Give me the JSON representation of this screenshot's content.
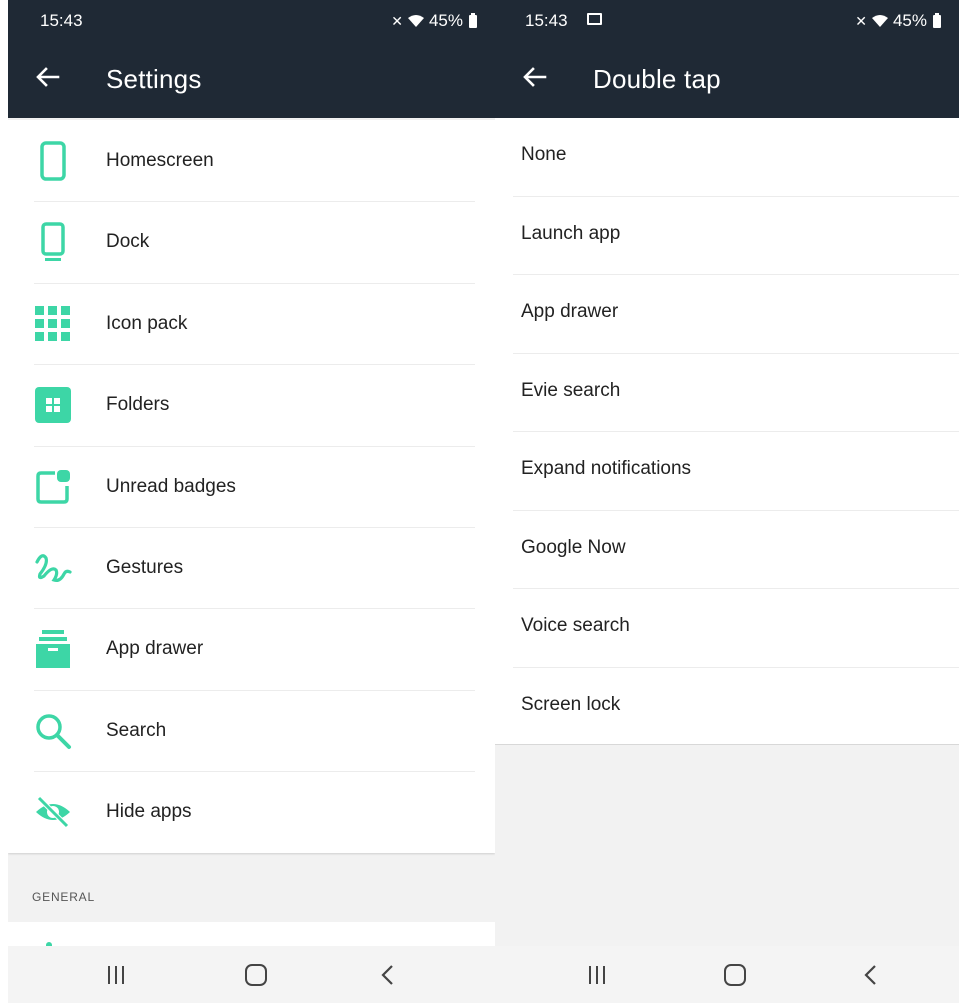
{
  "left": {
    "status": {
      "time": "15:43",
      "battery": "45%"
    },
    "appbar": {
      "title": "Settings"
    },
    "items": [
      {
        "label": "Homescreen",
        "icon": "phone-icon"
      },
      {
        "label": "Dock",
        "icon": "dock-icon"
      },
      {
        "label": "Icon pack",
        "icon": "grid-icon"
      },
      {
        "label": "Folders",
        "icon": "folder-icon"
      },
      {
        "label": "Unread badges",
        "icon": "badge-icon"
      },
      {
        "label": "Gestures",
        "icon": "gesture-icon"
      },
      {
        "label": "App drawer",
        "icon": "app-drawer-icon"
      },
      {
        "label": "Search",
        "icon": "search-icon"
      },
      {
        "label": "Hide apps",
        "icon": "hide-icon"
      }
    ],
    "section_label": "GENERAL"
  },
  "right": {
    "status": {
      "time": "15:43",
      "battery": "45%"
    },
    "appbar": {
      "title": "Double tap"
    },
    "options": [
      {
        "label": "None"
      },
      {
        "label": "Launch app"
      },
      {
        "label": "App drawer"
      },
      {
        "label": "Evie search"
      },
      {
        "label": "Expand notifications"
      },
      {
        "label": "Google Now"
      },
      {
        "label": "Voice search"
      },
      {
        "label": "Screen lock"
      }
    ]
  },
  "colors": {
    "accent": "#3dd6a6",
    "appbar": "#1f2935",
    "background": "#f2f2f2"
  }
}
